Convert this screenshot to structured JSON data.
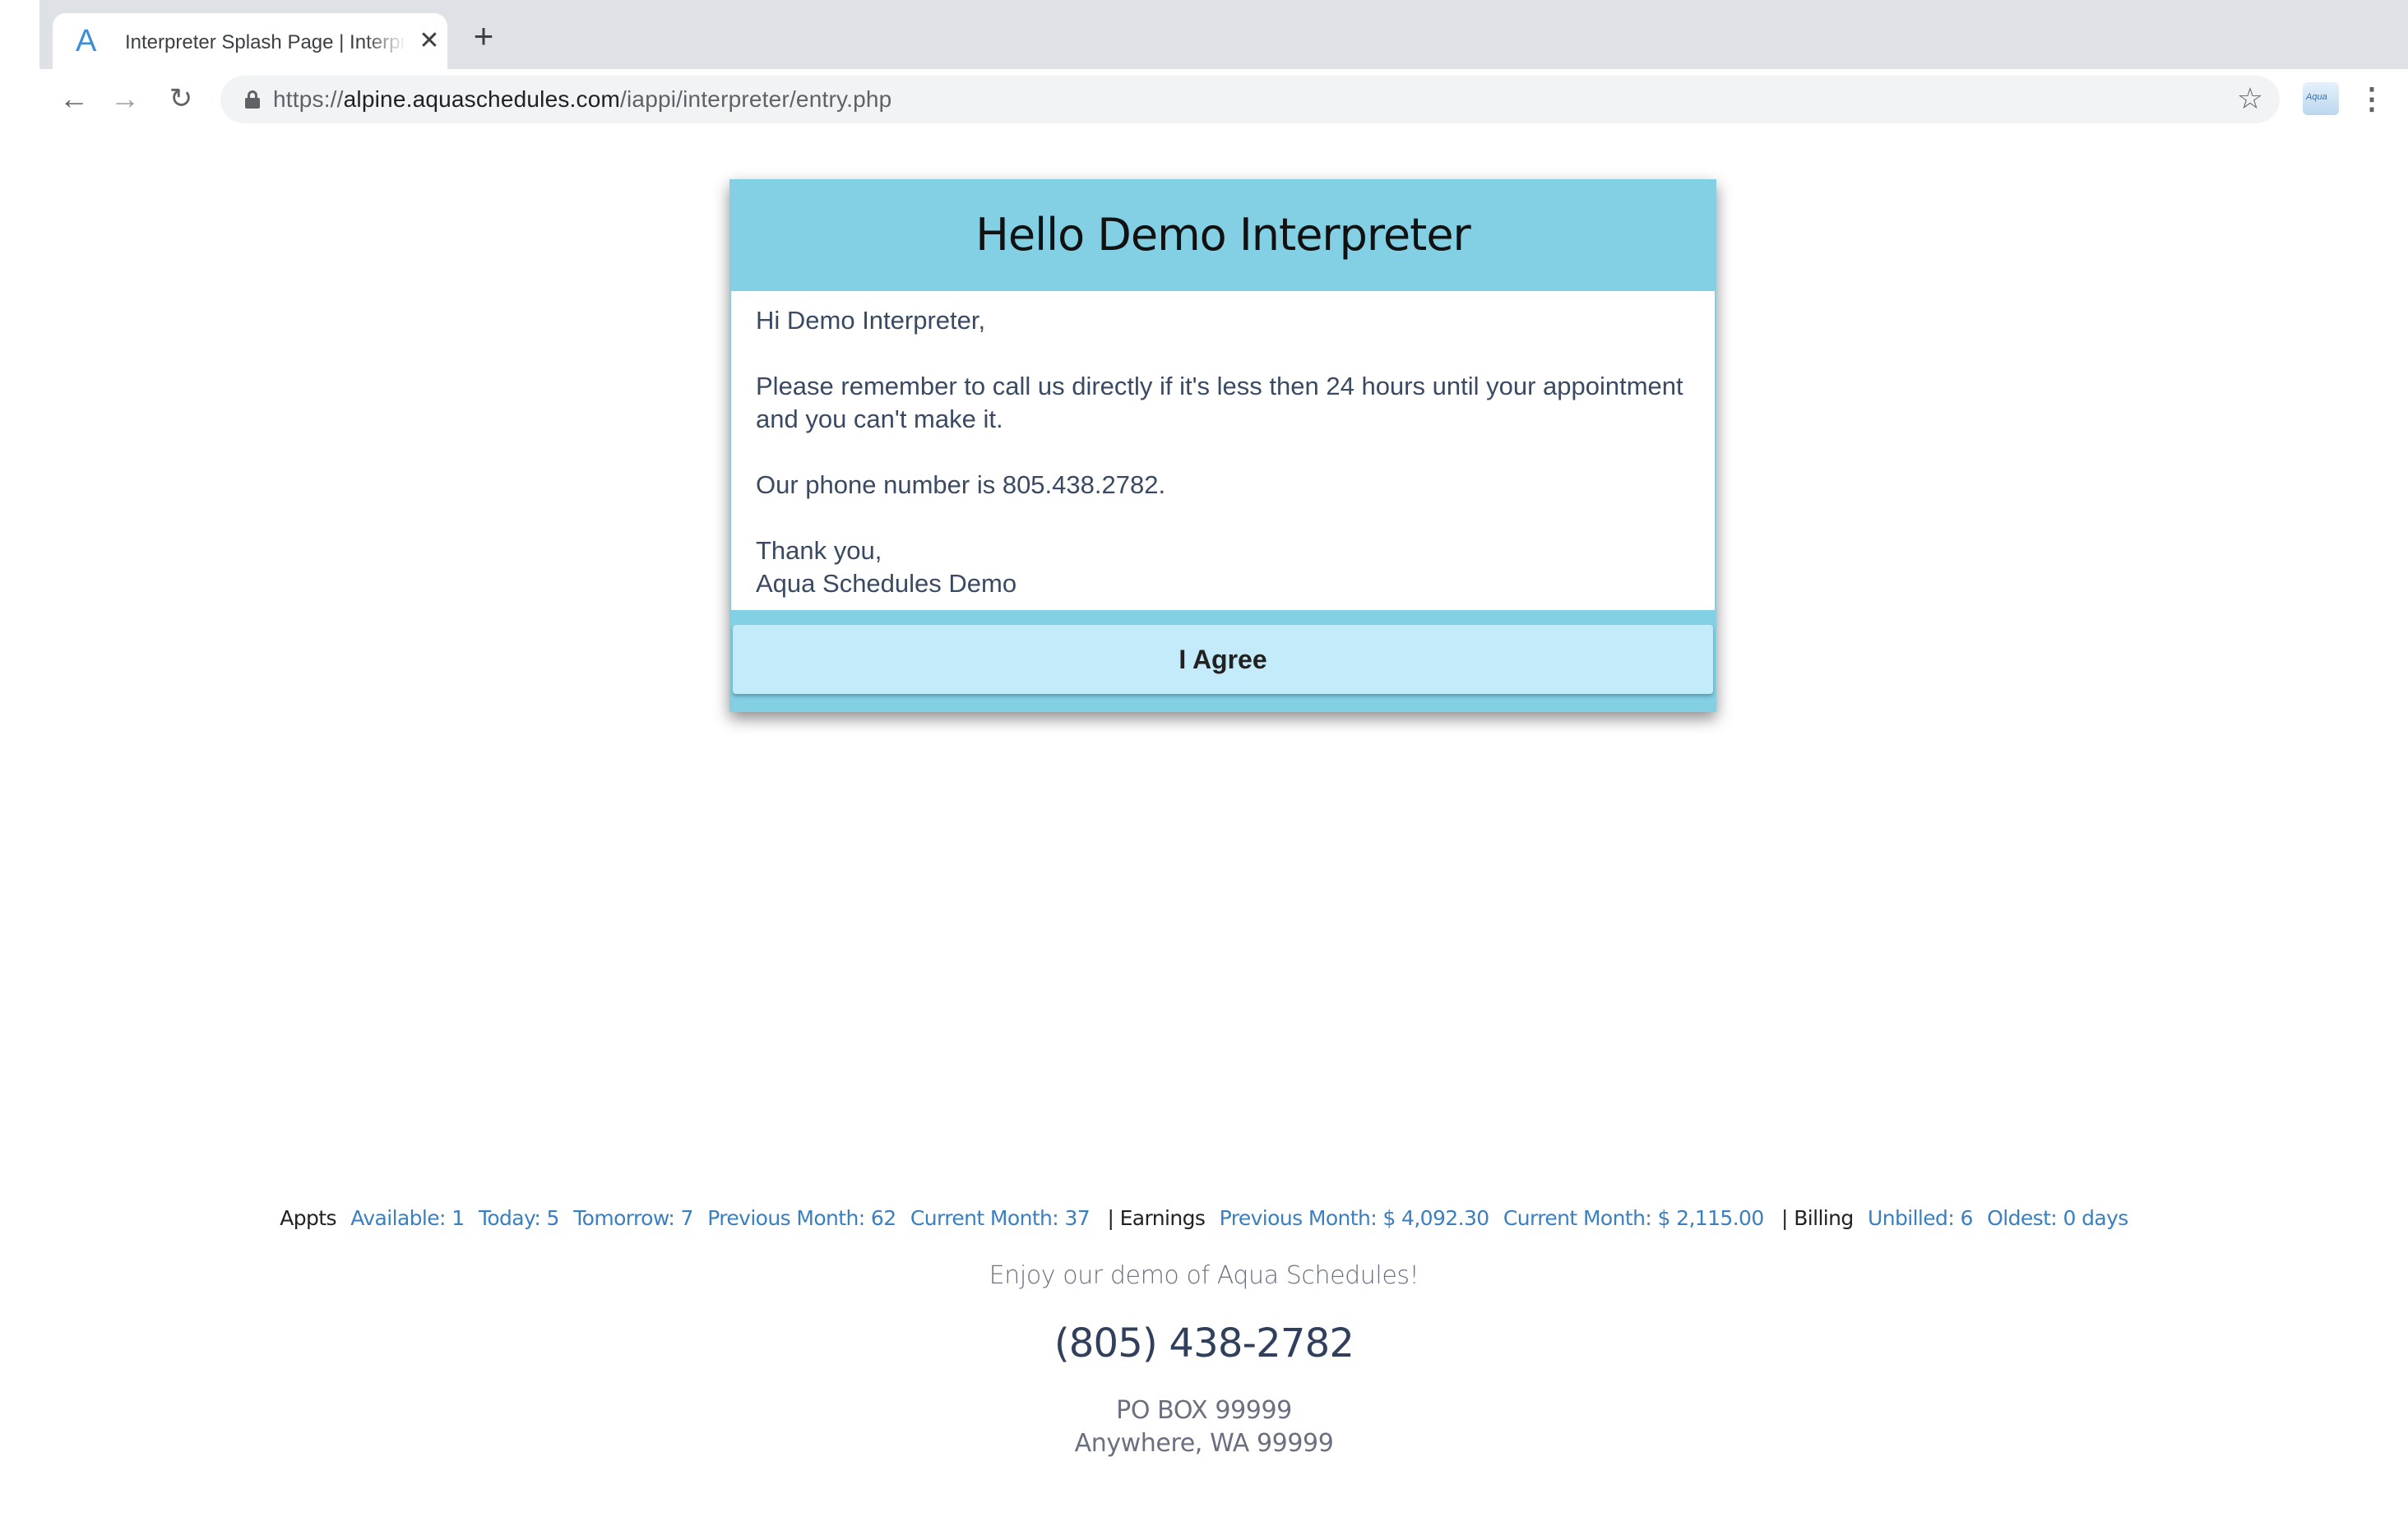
{
  "browser": {
    "tab_title": "Interpreter Splash Page | Interpreter",
    "tab_favicon": "A",
    "url_scheme": "https://",
    "url_host": "alpine.aquaschedules.com",
    "url_path": "/iappi/interpreter/entry.php",
    "icons": [
      "back-icon",
      "forward-icon",
      "reload-icon",
      "lock-icon",
      "star-icon",
      "extension-icon",
      "menu-icon",
      "close-icon",
      "new-tab-icon"
    ]
  },
  "modal": {
    "title": "Hello Demo Interpreter",
    "greeting": "Hi Demo Interpreter,",
    "reminder": "Please remember to call us directly if it's less then 24 hours until your appointment and you can't make it.",
    "phone_line": "Our phone number is 805.438.2782.",
    "thanks": "Thank you,",
    "signature": "Aqua Schedules Demo",
    "agree_label": "I Agree",
    "header_color": "#83cfe4",
    "button_color": "#c3ebfa"
  },
  "footer": {
    "appts_label": "Appts",
    "available": "Available: 1",
    "today": "Today: 5",
    "tomorrow": "Tomorrow: 7",
    "prev_month": "Previous Month: 62",
    "cur_month": "Current Month: 37",
    "earnings_label": "| Earnings",
    "earn_prev": "Previous Month: $ 4,092.30",
    "earn_cur": "Current Month: $ 2,115.00",
    "billing_label": "| Billing",
    "unbilled": "Unbilled: 6",
    "oldest": "Oldest: 0 days",
    "tagline": "Enjoy our demo of Aqua Schedules!",
    "phone": "(805) 438-2782",
    "address_line1": "PO BOX 99999",
    "address_line2": "Anywhere, WA 99999",
    "link_color": "#3a7fc0"
  }
}
